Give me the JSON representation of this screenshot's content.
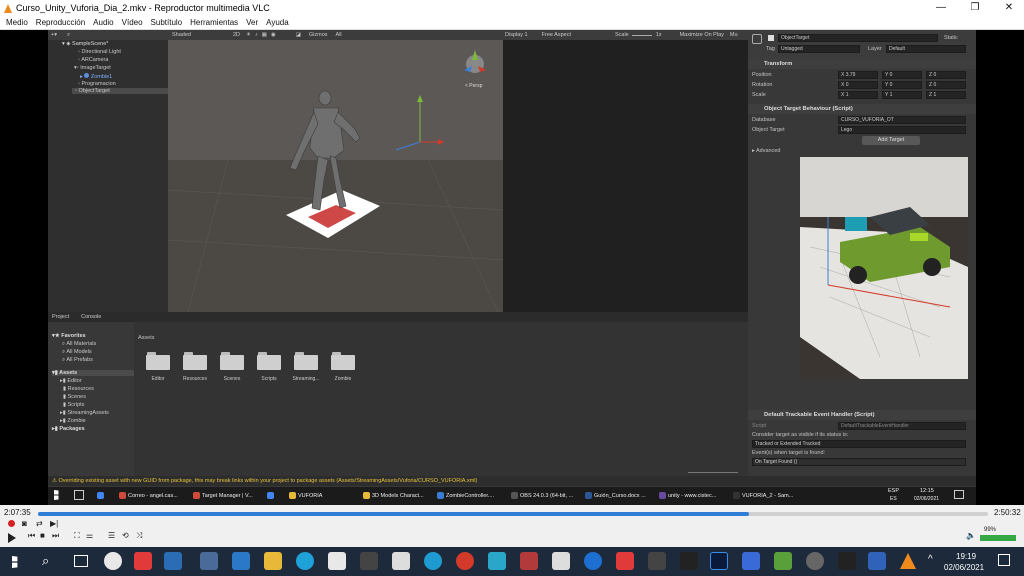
{
  "window": {
    "title": "Curso_Unity_Vuforia_Dia_2.mkv - Reproductor multimedia VLC",
    "controls": {
      "minimize": "—",
      "maximize": "❐",
      "close": "✕"
    }
  },
  "menu": [
    "Medio",
    "Reproducción",
    "Audio",
    "Vídeo",
    "Subtítulo",
    "Herramientas",
    "Ver",
    "Ayuda"
  ],
  "unity": {
    "hierarchy": {
      "scene": "SampleScene*",
      "items": [
        "Directional Light",
        "ARCamera",
        "ImageTarget",
        "Zombie1",
        "Programacion",
        "ObjectTarget"
      ]
    },
    "scene_toolbar": {
      "shading": "Shaded",
      "mode_2d": "2D",
      "gizmos": "Gizmos",
      "search": "All",
      "persp": "< Persp"
    },
    "game_toolbar": {
      "display": "Display 1",
      "aspect": "Free Aspect",
      "scale_label": "Scale",
      "scale_value": "1x",
      "maximize": "Maximize On Play",
      "mute": "Mu"
    },
    "project": {
      "tabs": [
        "Project",
        "Console"
      ],
      "favorites_label": "Favorites",
      "favorites": [
        "All Materials",
        "All Models",
        "All Prefabs"
      ],
      "assets_label": "Assets",
      "asset_tree": [
        "Editor",
        "Resources",
        "Scenes",
        "Scripts",
        "StreamingAssets",
        "Zombie"
      ],
      "packages_label": "Packages",
      "breadcrumb": "Assets",
      "folders": [
        "Editor",
        "Resources",
        "Scenes",
        "Scripts",
        "Streaming...",
        "Zombie"
      ]
    },
    "inspector": {
      "object_name": "ObjectTarget",
      "static_label": "Static",
      "tag_label": "Tag",
      "tag_value": "Untagged",
      "layer_label": "Layer",
      "layer_value": "Default",
      "transform": {
        "title": "Transform",
        "rows": [
          {
            "label": "Position",
            "x": "3.79",
            "y": "0",
            "z": "0"
          },
          {
            "label": "Rotation",
            "x": "0",
            "y": "0",
            "z": "0"
          },
          {
            "label": "Scale",
            "x": "1",
            "y": "1",
            "z": "1"
          }
        ]
      },
      "otb": {
        "title": "Object Target Behaviour (Script)",
        "database_label": "Database",
        "database_value": "CURSO_VUFORIA_OT",
        "target_label": "Object Target",
        "target_value": "Lego",
        "add_target": "Add Target",
        "advanced": "Advanced"
      },
      "dteh": {
        "title": "Default Trackable Event Handler (Script)",
        "script_label": "Script",
        "script_value": "DefaultTrackableEventHandler",
        "consider_label": "Consider target as visible if its status is:",
        "status_value": "Tracked or Extended Tracked",
        "event_label": "Event(s) when target is found:",
        "event_value": "On Target Found ()"
      }
    },
    "status_message": "Overriding existing asset with new GUID from package, this may break links within your project to package assets (Assets/StreamingAssets/Vuforia/CURSO_VUFORIA.xml)",
    "inner_taskbar": {
      "items": [
        {
          "label": "",
          "color": "#4285f4"
        },
        {
          "label": "Correo - angel.cas...",
          "color": "#d04a3a"
        },
        {
          "label": "Target Manager | V...",
          "color": "#d04a3a"
        },
        {
          "label": "",
          "color": "#4285f4"
        },
        {
          "label": "VUFORIA",
          "color": "#e8b838"
        },
        {
          "label": "3D Models Charact...",
          "color": "#e8b838"
        },
        {
          "label": "ZombieController....",
          "color": "#3a7bd5"
        },
        {
          "label": "OBS 24.0.3 (64-bit, ...",
          "color": "#555"
        },
        {
          "label": "Guión_Curso.docx ...",
          "color": "#2b5797"
        },
        {
          "label": "unity - www.cistec...",
          "color": "#6a4aa0"
        },
        {
          "label": "VUFORIA_2 - Sam...",
          "color": "#333"
        }
      ],
      "lang": "ESP",
      "lang2": "ES",
      "time": "12:15",
      "date": "02/06/2021"
    }
  },
  "player": {
    "elapsed": "2:07:35",
    "total": "2:50:32",
    "progress": 0.748,
    "volume": "99%",
    "volume_level": 0.99
  },
  "taskbar": {
    "time": "19:19",
    "date": "02/06/2021"
  }
}
